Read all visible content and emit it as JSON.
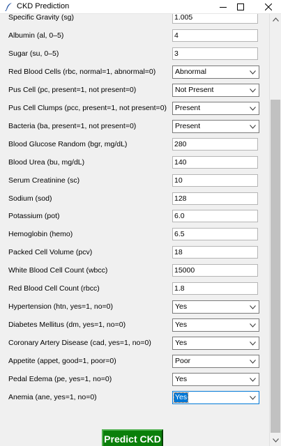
{
  "window": {
    "title": "CKD Prediction"
  },
  "fields": [
    {
      "label": "Specific Gravity (sg)",
      "value": "1.005",
      "type": "entry"
    },
    {
      "label": "Albumin (al, 0–5)",
      "value": "4",
      "type": "entry"
    },
    {
      "label": "Sugar (su, 0–5)",
      "value": "3",
      "type": "entry"
    },
    {
      "label": "Red Blood Cells (rbc, normal=1, abnormal=0)",
      "value": "Abnormal",
      "type": "combo"
    },
    {
      "label": "Pus Cell (pc, present=1, not present=0)",
      "value": "Not Present",
      "type": "combo"
    },
    {
      "label": "Pus Cell Clumps (pcc, present=1, not present=0)",
      "value": "Present",
      "type": "combo"
    },
    {
      "label": "Bacteria (ba, present=1, not present=0)",
      "value": "Present",
      "type": "combo"
    },
    {
      "label": "Blood Glucose Random (bgr, mg/dL)",
      "value": "280",
      "type": "entry"
    },
    {
      "label": "Blood Urea (bu, mg/dL)",
      "value": "140",
      "type": "entry"
    },
    {
      "label": "Serum Creatinine (sc)",
      "value": "10",
      "type": "entry"
    },
    {
      "label": "Sodium (sod)",
      "value": "128",
      "type": "entry"
    },
    {
      "label": "Potassium (pot)",
      "value": "6.0",
      "type": "entry"
    },
    {
      "label": "Hemoglobin (hemo)",
      "value": "6.5",
      "type": "entry"
    },
    {
      "label": "Packed Cell Volume (pcv)",
      "value": "18",
      "type": "entry"
    },
    {
      "label": "White Blood Cell Count (wbcc)",
      "value": "15000",
      "type": "entry"
    },
    {
      "label": "Red Blood Cell Count (rbcc)",
      "value": "1.8",
      "type": "entry"
    },
    {
      "label": "Hypertension (htn, yes=1, no=0)",
      "value": "Yes",
      "type": "combo"
    },
    {
      "label": "Diabetes Mellitus (dm, yes=1, no=0)",
      "value": "Yes",
      "type": "combo"
    },
    {
      "label": "Coronary Artery Disease (cad, yes=1, no=0)",
      "value": "Yes",
      "type": "combo"
    },
    {
      "label": "Appetite (appet, good=1, poor=0)",
      "value": "Poor",
      "type": "combo"
    },
    {
      "label": "Pedal Edema (pe, yes=1, no=0)",
      "value": "Yes",
      "type": "combo"
    },
    {
      "label": "Anemia (ane, yes=1, no=0)",
      "value": "Yes",
      "type": "combo",
      "focused": true
    }
  ],
  "predict_button": {
    "label": "Predict CKD",
    "color": "#0a7f0a"
  },
  "scrollbar": {
    "position": 0.25
  }
}
